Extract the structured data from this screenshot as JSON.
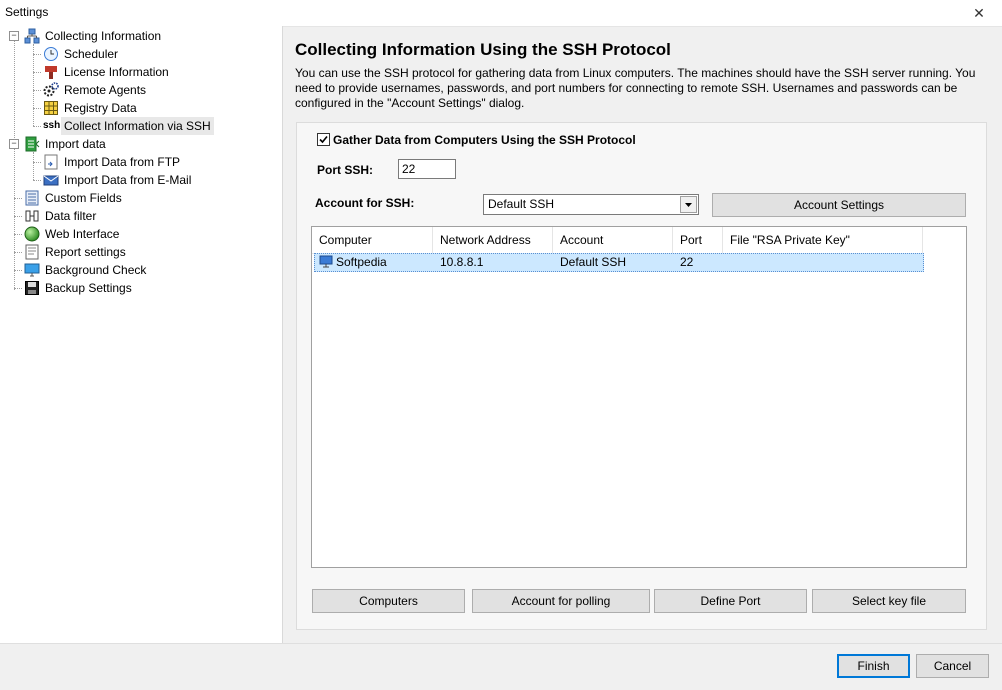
{
  "window": {
    "title": "Settings",
    "close_glyph": "✕"
  },
  "tree": {
    "items": [
      {
        "label": "Collecting Information",
        "icon": "network-icon"
      },
      {
        "label": "Scheduler",
        "icon": "clock-icon"
      },
      {
        "label": "License Information",
        "icon": "license-icon"
      },
      {
        "label": "Remote Agents",
        "icon": "gears-icon"
      },
      {
        "label": "Registry Data",
        "icon": "registry-grid-icon"
      },
      {
        "label": "Collect Information via SSH",
        "icon": "ssh-icon",
        "icon_text": "ssh"
      },
      {
        "label": "Import data",
        "icon": "import-icon"
      },
      {
        "label": "Import Data from FTP",
        "icon": "ftp-icon"
      },
      {
        "label": "Import Data from E-Mail",
        "icon": "email-icon"
      },
      {
        "label": "Custom Fields",
        "icon": "fields-icon"
      },
      {
        "label": "Data filter",
        "icon": "filter-icon"
      },
      {
        "label": "Web Interface",
        "icon": "globe-icon"
      },
      {
        "label": "Report settings",
        "icon": "report-icon"
      },
      {
        "label": "Background Check",
        "icon": "monitor-icon"
      },
      {
        "label": "Backup Settings",
        "icon": "floppy-icon"
      }
    ],
    "expander_collapse": "−"
  },
  "main": {
    "title": "Collecting Information Using the SSH Protocol",
    "description": "You can use the SSH protocol for gathering data from Linux computers. The machines should have the SSH server running. You need to provide usernames, passwords, and port numbers for connecting to remote SSH. Usernames and passwords can be configured in the \"Account Settings\" dialog.",
    "gather_checkbox_label": "Gather Data from Computers Using the SSH Protocol",
    "gather_checked": true,
    "port_label": "Port SSH:",
    "port_value": "22",
    "account_label": "Account for SSH:",
    "account_value": "Default SSH",
    "account_settings_button": "Account Settings",
    "grid": {
      "columns": [
        "Computer",
        "Network Address",
        "Account",
        "Port",
        "File \"RSA Private Key\""
      ],
      "rows": [
        {
          "computer": "Softpedia",
          "address": "10.8.8.1",
          "account": "Default SSH",
          "port": "22",
          "file": ""
        }
      ]
    },
    "buttons": {
      "computers": "Computers",
      "account_polling": "Account for polling",
      "define_port": "Define Port",
      "select_key": "Select key file"
    }
  },
  "footer": {
    "finish": "Finish",
    "cancel": "Cancel"
  },
  "colors": {
    "selection": "#cce8ff",
    "accent": "#0078d7"
  }
}
